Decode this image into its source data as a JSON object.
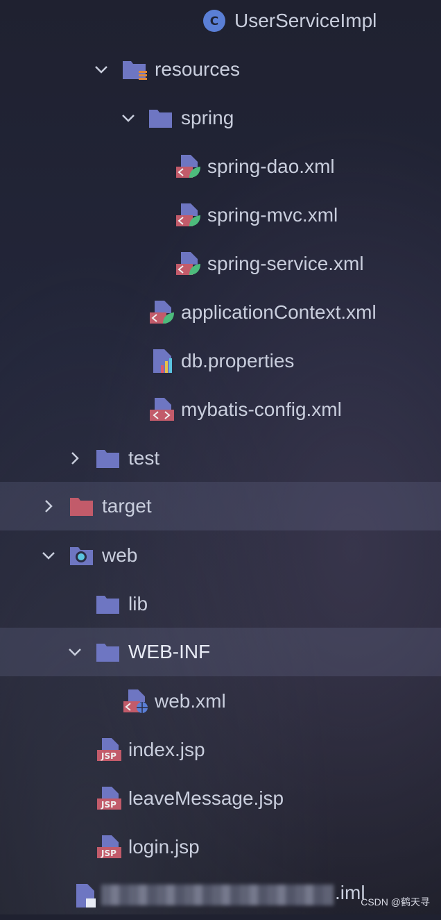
{
  "tree": [
    {
      "label": "UserServiceImpl",
      "icon": "class-icon"
    },
    {
      "label": "resources",
      "icon": "resources-folder-icon",
      "expanded": true
    },
    {
      "label": "spring",
      "icon": "folder-icon",
      "expanded": true
    },
    {
      "label": "spring-dao.xml",
      "icon": "spring-xml-icon"
    },
    {
      "label": "spring-mvc.xml",
      "icon": "spring-xml-icon"
    },
    {
      "label": "spring-service.xml",
      "icon": "spring-xml-icon"
    },
    {
      "label": "applicationContext.xml",
      "icon": "spring-xml-icon"
    },
    {
      "label": "db.properties",
      "icon": "properties-file-icon"
    },
    {
      "label": "mybatis-config.xml",
      "icon": "xml-file-icon"
    },
    {
      "label": "test",
      "icon": "folder-icon",
      "expanded": false
    },
    {
      "label": "target",
      "icon": "excluded-folder-icon",
      "expanded": false
    },
    {
      "label": "web",
      "icon": "web-folder-icon",
      "expanded": true
    },
    {
      "label": "lib",
      "icon": "folder-icon"
    },
    {
      "label": "WEB-INF",
      "icon": "folder-icon",
      "expanded": true
    },
    {
      "label": "web.xml",
      "icon": "web-xml-icon"
    },
    {
      "label": "index.jsp",
      "icon": "jsp-file-icon"
    },
    {
      "label": "leaveMessage.jsp",
      "icon": "jsp-file-icon"
    },
    {
      "label": "login.jsp",
      "icon": "jsp-file-icon"
    }
  ],
  "iml_file": {
    "suffix": ".iml",
    "icon": "module-file-icon"
  },
  "watermark": "CSDN @鹤天寻",
  "colors": {
    "folder": "#6e76c2",
    "excluded_folder": "#c25b6a",
    "class_circle": "#5a7fd6",
    "spring_green": "#4dbb7c",
    "jsp_red": "#c25b6a",
    "bg": "#22253a"
  }
}
